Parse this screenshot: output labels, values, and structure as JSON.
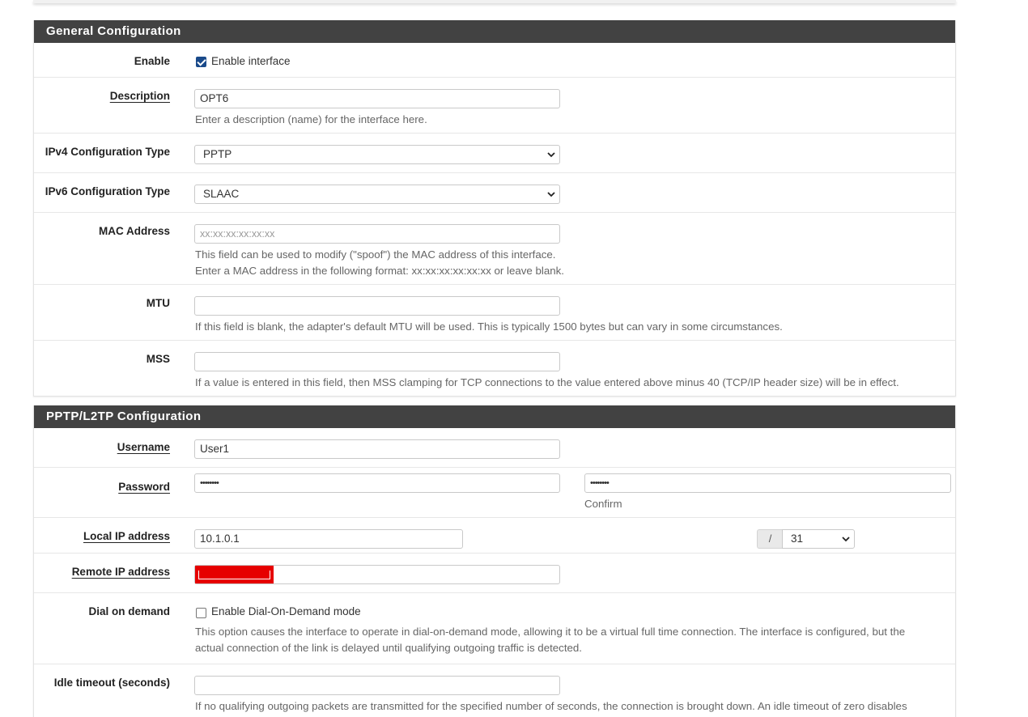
{
  "general": {
    "heading": "General Configuration",
    "enable": {
      "label": "Enable",
      "checked": true,
      "text": "Enable interface"
    },
    "description": {
      "label": "Description",
      "value": "OPT6",
      "help": "Enter a description (name) for the interface here."
    },
    "ipv4": {
      "label": "IPv4 Configuration Type",
      "selected": "PPTP"
    },
    "ipv6": {
      "label": "IPv6 Configuration Type",
      "selected": "SLAAC"
    },
    "mac": {
      "label": "MAC Address",
      "placeholder": "xx:xx:xx:xx:xx:xx",
      "help1": "This field can be used to modify (\"spoof\") the MAC address of this interface.",
      "help2": "Enter a MAC address in the following format: xx:xx:xx:xx:xx:xx or leave blank."
    },
    "mtu": {
      "label": "MTU",
      "value": "",
      "help": "If this field is blank, the adapter's default MTU will be used. This is typically 1500 bytes but can vary in some circumstances."
    },
    "mss": {
      "label": "MSS",
      "value": "",
      "help": "If a value is entered in this field, then MSS clamping for TCP connections to the value entered above minus 40 (TCP/IP header size) will be in effect."
    }
  },
  "pptp": {
    "heading": "PPTP/L2TP Configuration",
    "username": {
      "label": "Username",
      "value": "User1"
    },
    "password": {
      "label": "Password",
      "value": "••••••••",
      "confirm_value": "••••••••",
      "confirm_label": "Confirm"
    },
    "local_ip": {
      "label": "Local IP address",
      "value": "10.1.0.1",
      "slash": "/",
      "cidr": "31"
    },
    "remote_ip": {
      "label": "Remote IP address",
      "value": ""
    },
    "dial": {
      "label": "Dial on demand",
      "checked": false,
      "text": "Enable Dial-On-Demand mode",
      "help1": "This option causes the interface to operate in dial-on-demand mode, allowing it to be a virtual full time connection. The interface is configured, but the",
      "help2": "actual connection of the link is delayed until qualifying outgoing traffic is detected."
    },
    "idle": {
      "label": "Idle timeout (seconds)",
      "value": "",
      "help": "If no qualifying outgoing packets are transmitted for the specified number of seconds, the connection is brought down. An idle timeout of zero disables"
    }
  },
  "colors": {
    "heading_bg": "#424242",
    "checkbox_accent": "#1a4a8a",
    "redaction": "#e60000"
  },
  "icons": {
    "select_arrow": "chevron-down-icon",
    "checkmark": "checkmark-icon"
  }
}
